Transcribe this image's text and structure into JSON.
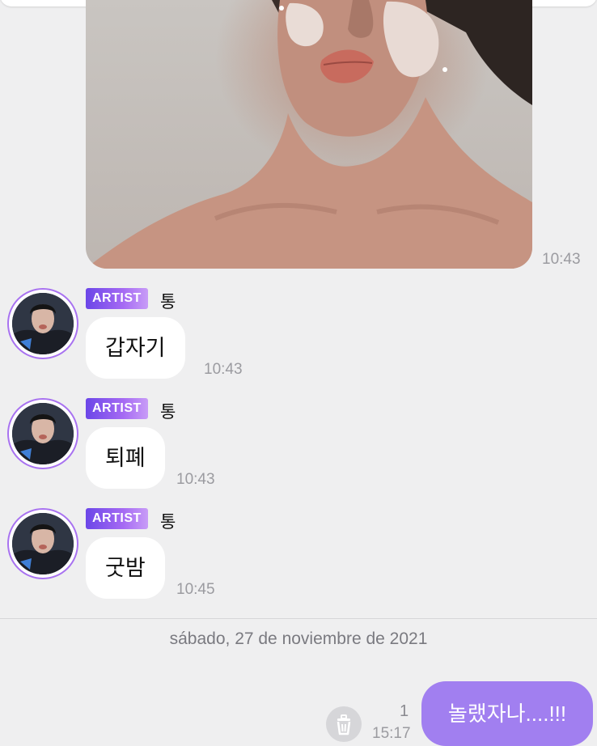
{
  "photo_message": {
    "time": "10:43"
  },
  "messages": [
    {
      "badge": "ARTIST",
      "sender": "통",
      "text": "갑자기",
      "time": "10:43"
    },
    {
      "badge": "ARTIST",
      "sender": "통",
      "text": "퇴폐",
      "time": "10:43"
    },
    {
      "badge": "ARTIST",
      "sender": "통",
      "text": "굿밤",
      "time": "10:45"
    }
  ],
  "date_separator": "sábado, 27 de noviembre de 2021",
  "my_message": {
    "text": "놀랬자나....!!!",
    "unread_count": "1",
    "time": "15:17"
  },
  "colors": {
    "background": "#efeff0",
    "bubble": "#ffffff",
    "my_bubble": "#a17ff0",
    "artist_badge": "#7a52ec",
    "avatar_ring": "#a872f0"
  },
  "icons": {
    "delete": "trash-icon"
  }
}
